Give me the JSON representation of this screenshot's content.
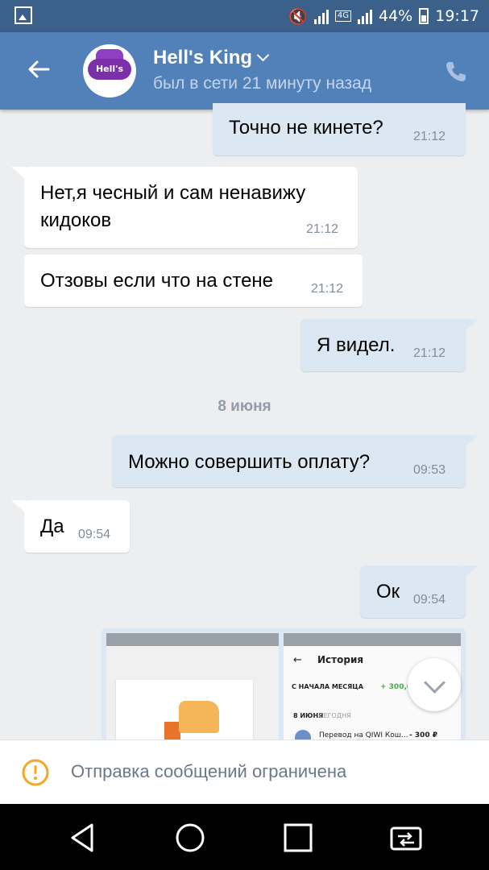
{
  "status_bar": {
    "network": "4G",
    "battery": "44%",
    "time": "19:17"
  },
  "header": {
    "title": "Hell's King",
    "subtitle": "был в сети 21 минуту назад",
    "avatar_text": "Hell's king",
    "icons": [
      "back-arrow-icon",
      "chevron-down-icon",
      "phone-icon"
    ]
  },
  "messages": [
    {
      "dir": "out",
      "text": "Точно не кинете?",
      "time": "21:12"
    },
    {
      "dir": "in",
      "text": "Нет,я чесный и сам ненавижу\nкидоков",
      "time": "21:12"
    },
    {
      "dir": "in",
      "text": "Отзовы если что на стене",
      "time": "21:12"
    },
    {
      "dir": "out",
      "text": "Я видел.",
      "time": "21:12"
    },
    {
      "dir": "out",
      "text": "Можно совершить оплату?",
      "time": "09:53"
    },
    {
      "dir": "in",
      "text": "Да",
      "time": "09:54"
    },
    {
      "dir": "out",
      "text": "Ок",
      "time": "09:54"
    }
  ],
  "date_separator": "8 июня",
  "attachment": {
    "screenshot2": {
      "title": "История",
      "row_period": "С НАЧАЛА МЕСЯЦА",
      "row_amount": "+ 300,00",
      "day_label": "8 ИЮНЯ",
      "day_sub": "СЕГОДНЯ",
      "transfer": "Перевод на QIWI Кош...",
      "transfer_amount": "- 300 ₽"
    }
  },
  "restriction": {
    "text": "Отправка сообщений ограничена",
    "accent": "#f5a623"
  },
  "navbar": {
    "icons": [
      "nav-back-icon",
      "nav-home-icon",
      "nav-recents-icon",
      "nav-switch-icon"
    ]
  },
  "colors": {
    "header": "#5181b8",
    "status_bar": "#3b618b",
    "incoming": "#ffffff",
    "outgoing": "#dce7f4"
  }
}
